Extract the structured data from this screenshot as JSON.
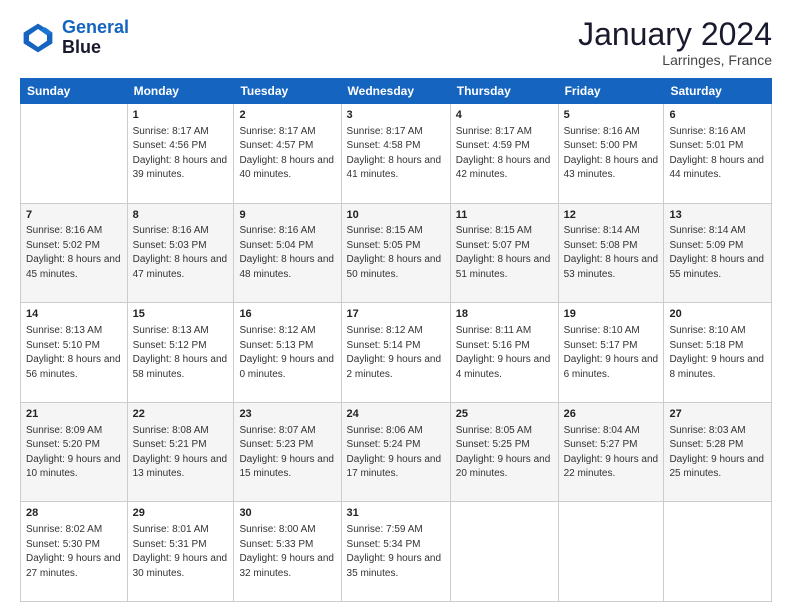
{
  "header": {
    "logo_line1": "General",
    "logo_line2": "Blue",
    "month": "January 2024",
    "location": "Larringes, France"
  },
  "weekdays": [
    "Sunday",
    "Monday",
    "Tuesday",
    "Wednesday",
    "Thursday",
    "Friday",
    "Saturday"
  ],
  "weeks": [
    [
      {
        "day": "",
        "sunrise": "",
        "sunset": "",
        "daylight": ""
      },
      {
        "day": "1",
        "sunrise": "Sunrise: 8:17 AM",
        "sunset": "Sunset: 4:56 PM",
        "daylight": "Daylight: 8 hours and 39 minutes."
      },
      {
        "day": "2",
        "sunrise": "Sunrise: 8:17 AM",
        "sunset": "Sunset: 4:57 PM",
        "daylight": "Daylight: 8 hours and 40 minutes."
      },
      {
        "day": "3",
        "sunrise": "Sunrise: 8:17 AM",
        "sunset": "Sunset: 4:58 PM",
        "daylight": "Daylight: 8 hours and 41 minutes."
      },
      {
        "day": "4",
        "sunrise": "Sunrise: 8:17 AM",
        "sunset": "Sunset: 4:59 PM",
        "daylight": "Daylight: 8 hours and 42 minutes."
      },
      {
        "day": "5",
        "sunrise": "Sunrise: 8:16 AM",
        "sunset": "Sunset: 5:00 PM",
        "daylight": "Daylight: 8 hours and 43 minutes."
      },
      {
        "day": "6",
        "sunrise": "Sunrise: 8:16 AM",
        "sunset": "Sunset: 5:01 PM",
        "daylight": "Daylight: 8 hours and 44 minutes."
      }
    ],
    [
      {
        "day": "7",
        "sunrise": "Sunrise: 8:16 AM",
        "sunset": "Sunset: 5:02 PM",
        "daylight": "Daylight: 8 hours and 45 minutes."
      },
      {
        "day": "8",
        "sunrise": "Sunrise: 8:16 AM",
        "sunset": "Sunset: 5:03 PM",
        "daylight": "Daylight: 8 hours and 47 minutes."
      },
      {
        "day": "9",
        "sunrise": "Sunrise: 8:16 AM",
        "sunset": "Sunset: 5:04 PM",
        "daylight": "Daylight: 8 hours and 48 minutes."
      },
      {
        "day": "10",
        "sunrise": "Sunrise: 8:15 AM",
        "sunset": "Sunset: 5:05 PM",
        "daylight": "Daylight: 8 hours and 50 minutes."
      },
      {
        "day": "11",
        "sunrise": "Sunrise: 8:15 AM",
        "sunset": "Sunset: 5:07 PM",
        "daylight": "Daylight: 8 hours and 51 minutes."
      },
      {
        "day": "12",
        "sunrise": "Sunrise: 8:14 AM",
        "sunset": "Sunset: 5:08 PM",
        "daylight": "Daylight: 8 hours and 53 minutes."
      },
      {
        "day": "13",
        "sunrise": "Sunrise: 8:14 AM",
        "sunset": "Sunset: 5:09 PM",
        "daylight": "Daylight: 8 hours and 55 minutes."
      }
    ],
    [
      {
        "day": "14",
        "sunrise": "Sunrise: 8:13 AM",
        "sunset": "Sunset: 5:10 PM",
        "daylight": "Daylight: 8 hours and 56 minutes."
      },
      {
        "day": "15",
        "sunrise": "Sunrise: 8:13 AM",
        "sunset": "Sunset: 5:12 PM",
        "daylight": "Daylight: 8 hours and 58 minutes."
      },
      {
        "day": "16",
        "sunrise": "Sunrise: 8:12 AM",
        "sunset": "Sunset: 5:13 PM",
        "daylight": "Daylight: 9 hours and 0 minutes."
      },
      {
        "day": "17",
        "sunrise": "Sunrise: 8:12 AM",
        "sunset": "Sunset: 5:14 PM",
        "daylight": "Daylight: 9 hours and 2 minutes."
      },
      {
        "day": "18",
        "sunrise": "Sunrise: 8:11 AM",
        "sunset": "Sunset: 5:16 PM",
        "daylight": "Daylight: 9 hours and 4 minutes."
      },
      {
        "day": "19",
        "sunrise": "Sunrise: 8:10 AM",
        "sunset": "Sunset: 5:17 PM",
        "daylight": "Daylight: 9 hours and 6 minutes."
      },
      {
        "day": "20",
        "sunrise": "Sunrise: 8:10 AM",
        "sunset": "Sunset: 5:18 PM",
        "daylight": "Daylight: 9 hours and 8 minutes."
      }
    ],
    [
      {
        "day": "21",
        "sunrise": "Sunrise: 8:09 AM",
        "sunset": "Sunset: 5:20 PM",
        "daylight": "Daylight: 9 hours and 10 minutes."
      },
      {
        "day": "22",
        "sunrise": "Sunrise: 8:08 AM",
        "sunset": "Sunset: 5:21 PM",
        "daylight": "Daylight: 9 hours and 13 minutes."
      },
      {
        "day": "23",
        "sunrise": "Sunrise: 8:07 AM",
        "sunset": "Sunset: 5:23 PM",
        "daylight": "Daylight: 9 hours and 15 minutes."
      },
      {
        "day": "24",
        "sunrise": "Sunrise: 8:06 AM",
        "sunset": "Sunset: 5:24 PM",
        "daylight": "Daylight: 9 hours and 17 minutes."
      },
      {
        "day": "25",
        "sunrise": "Sunrise: 8:05 AM",
        "sunset": "Sunset: 5:25 PM",
        "daylight": "Daylight: 9 hours and 20 minutes."
      },
      {
        "day": "26",
        "sunrise": "Sunrise: 8:04 AM",
        "sunset": "Sunset: 5:27 PM",
        "daylight": "Daylight: 9 hours and 22 minutes."
      },
      {
        "day": "27",
        "sunrise": "Sunrise: 8:03 AM",
        "sunset": "Sunset: 5:28 PM",
        "daylight": "Daylight: 9 hours and 25 minutes."
      }
    ],
    [
      {
        "day": "28",
        "sunrise": "Sunrise: 8:02 AM",
        "sunset": "Sunset: 5:30 PM",
        "daylight": "Daylight: 9 hours and 27 minutes."
      },
      {
        "day": "29",
        "sunrise": "Sunrise: 8:01 AM",
        "sunset": "Sunset: 5:31 PM",
        "daylight": "Daylight: 9 hours and 30 minutes."
      },
      {
        "day": "30",
        "sunrise": "Sunrise: 8:00 AM",
        "sunset": "Sunset: 5:33 PM",
        "daylight": "Daylight: 9 hours and 32 minutes."
      },
      {
        "day": "31",
        "sunrise": "Sunrise: 7:59 AM",
        "sunset": "Sunset: 5:34 PM",
        "daylight": "Daylight: 9 hours and 35 minutes."
      },
      {
        "day": "",
        "sunrise": "",
        "sunset": "",
        "daylight": ""
      },
      {
        "day": "",
        "sunrise": "",
        "sunset": "",
        "daylight": ""
      },
      {
        "day": "",
        "sunrise": "",
        "sunset": "",
        "daylight": ""
      }
    ]
  ]
}
